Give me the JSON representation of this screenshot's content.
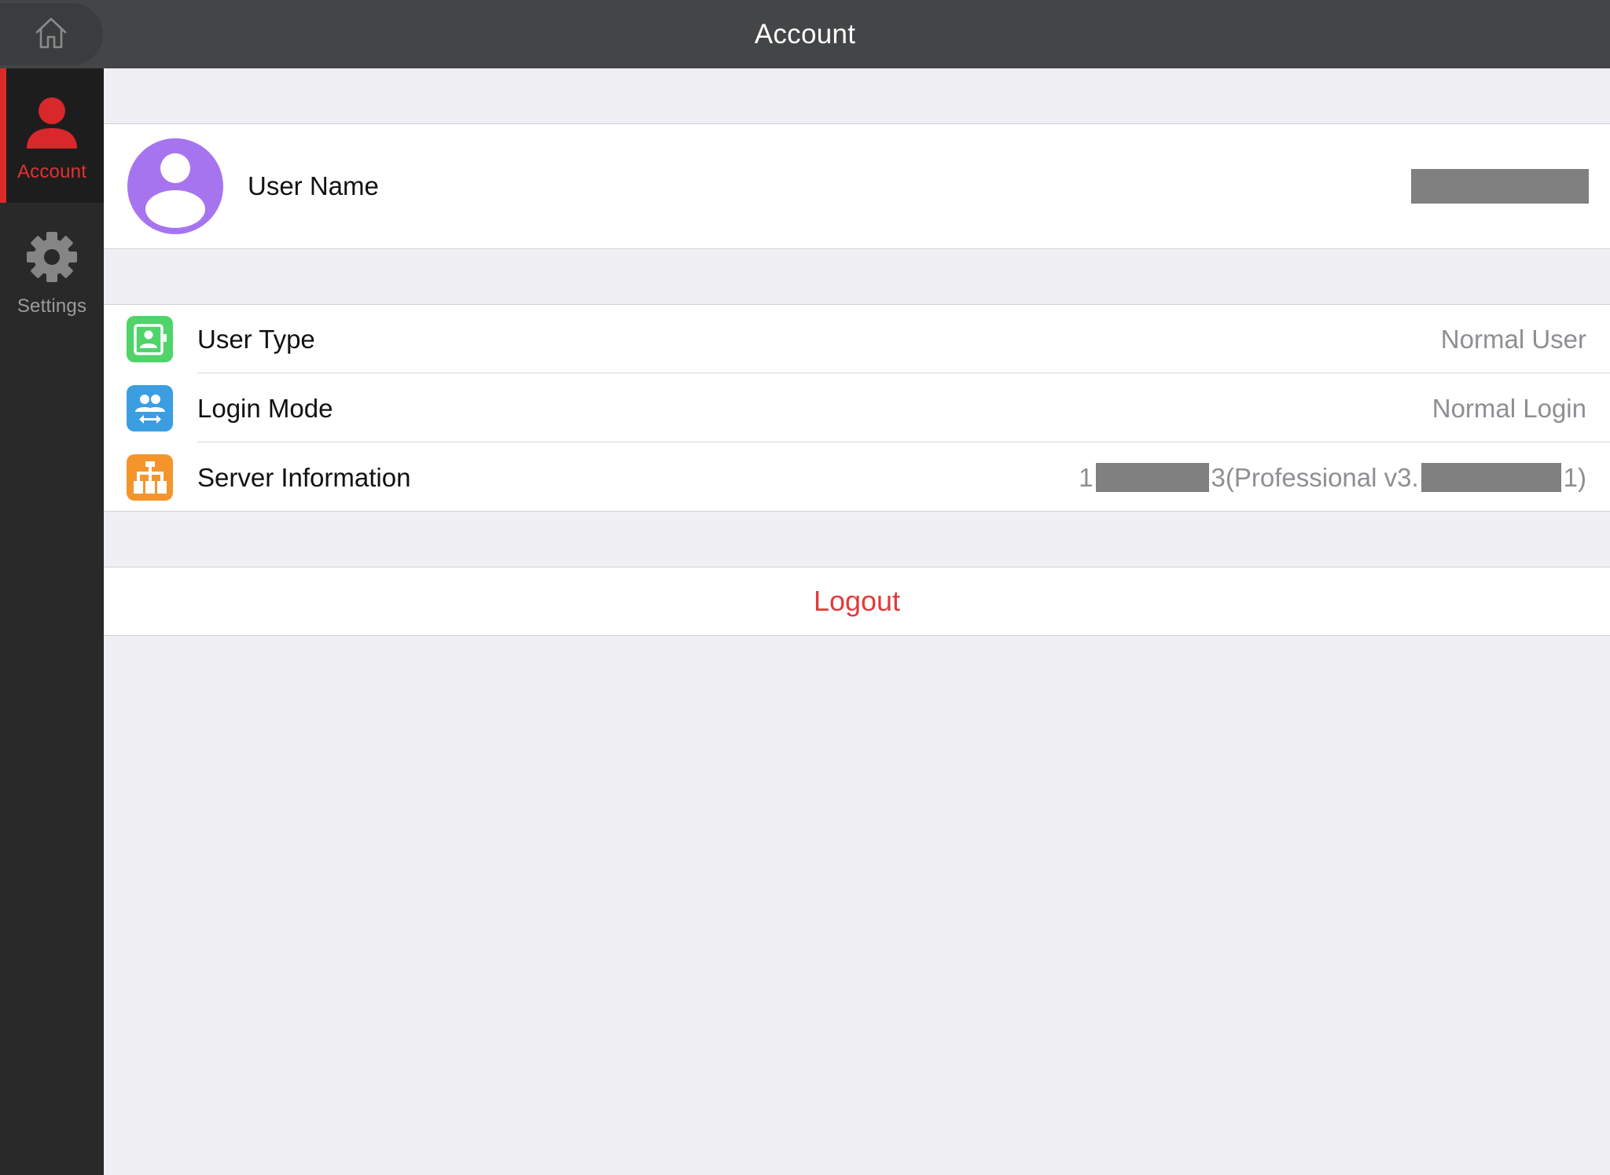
{
  "header": {
    "title": "Account",
    "home_icon": "home-icon"
  },
  "sidebar": {
    "items": [
      {
        "label": "Account",
        "icon": "account-icon",
        "active": true,
        "color": "#e5312f"
      },
      {
        "label": "Settings",
        "icon": "gear-icon",
        "active": false,
        "color": "#9c9c9c"
      }
    ]
  },
  "user": {
    "label": "User Name",
    "avatar_icon": "avatar-icon",
    "avatar_color": "#a774ef"
  },
  "info": {
    "rows": [
      {
        "label": "User Type",
        "value": "Normal User",
        "icon": "user-type-icon",
        "icon_color": "#4fd36a"
      },
      {
        "label": "Login Mode",
        "value": "Normal Login",
        "icon": "login-mode-icon",
        "icon_color": "#3a9ee0"
      },
      {
        "label": "Server Information",
        "value_parts": [
          "1",
          "3(Professional v3.",
          "1)"
        ],
        "icon": "server-icon",
        "icon_color": "#f3952b"
      }
    ]
  },
  "logout": {
    "label": "Logout",
    "color": "#e13b3b"
  }
}
